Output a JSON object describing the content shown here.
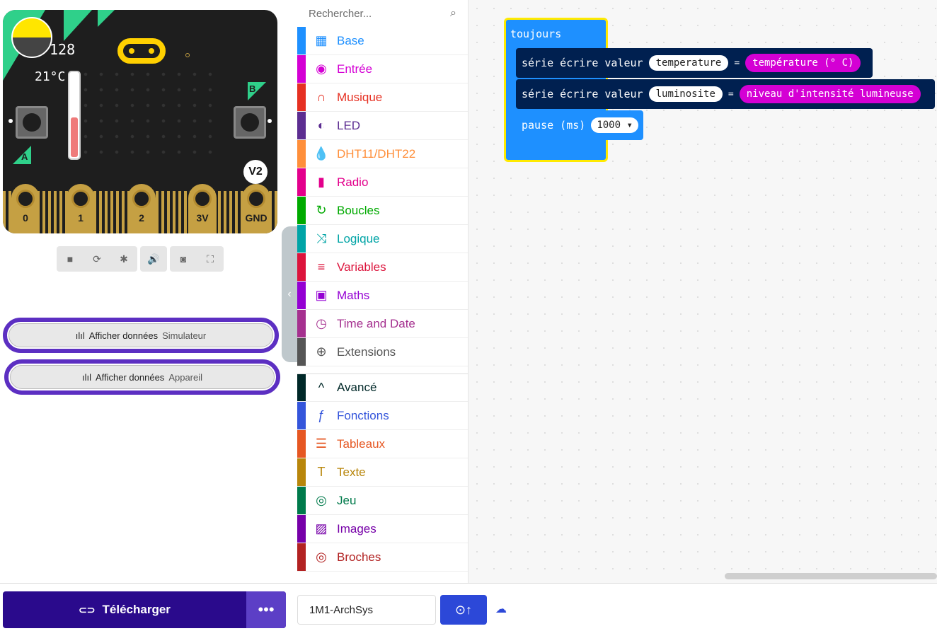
{
  "simulator": {
    "light_level": "128",
    "temperature": "21°C",
    "temperature_fill": 0.46,
    "button_a": "A",
    "button_b": "B",
    "version_badge": "V2",
    "pins": [
      "0",
      "1",
      "2",
      "3V",
      "GND"
    ],
    "controls": [
      "stop-icon",
      "restart-icon",
      "debug-icon",
      "sound-icon",
      "screenshot-icon",
      "fullscreen-icon"
    ]
  },
  "data_buttons": [
    {
      "label": "Afficher données",
      "sub": "Simulateur"
    },
    {
      "label": "Afficher données",
      "sub": "Appareil"
    }
  ],
  "toolbox": {
    "search_placeholder": "Rechercher...",
    "categories": [
      {
        "label": "Base",
        "color": "#1e90ff",
        "icon": "grid-icon"
      },
      {
        "label": "Entrée",
        "color": "#d400d4",
        "icon": "radio-button-icon"
      },
      {
        "label": "Musique",
        "color": "#e63022",
        "icon": "headphones-icon"
      },
      {
        "label": "LED",
        "color": "#5c2d91",
        "icon": "toggle-icon"
      },
      {
        "label": "DHT11/DHT22",
        "color": "#ff8f3a",
        "icon": "drop-icon"
      },
      {
        "label": "Radio",
        "color": "#e3008c",
        "icon": "signal-icon"
      },
      {
        "label": "Boucles",
        "color": "#00aa00",
        "icon": "refresh-icon"
      },
      {
        "label": "Logique",
        "color": "#00a4a6",
        "icon": "shuffle-icon"
      },
      {
        "label": "Variables",
        "color": "#dc143c",
        "icon": "list-icon"
      },
      {
        "label": "Maths",
        "color": "#9400d3",
        "icon": "calculator-icon"
      },
      {
        "label": "Time and Date",
        "color": "#a5308f",
        "icon": "clock-icon"
      },
      {
        "label": "Extensions",
        "color": "#555555",
        "icon": "plus-circle-icon"
      }
    ],
    "advanced": [
      {
        "label": "Avancé",
        "color": "#002828",
        "icon": "chevron-up-icon"
      },
      {
        "label": "Fonctions",
        "color": "#3455db",
        "icon": "function-icon"
      },
      {
        "label": "Tableaux",
        "color": "#e65722",
        "icon": "list-ordered-icon"
      },
      {
        "label": "Texte",
        "color": "#b8860b",
        "icon": "text-icon"
      },
      {
        "label": "Jeu",
        "color": "#007a4b",
        "icon": "gamepad-icon"
      },
      {
        "label": "Images",
        "color": "#7600a8",
        "icon": "image-icon"
      },
      {
        "label": "Broches",
        "color": "#b22222",
        "icon": "target-icon"
      }
    ]
  },
  "workspace": {
    "forever_label": "toujours",
    "serial_blocks": [
      {
        "text": "série écrire valeur",
        "name": "temperature",
        "eq": "=",
        "value": "température (° C)"
      },
      {
        "text": "série écrire valeur",
        "name": "luminosite",
        "eq": "=",
        "value": "niveau d'intensité lumineuse"
      }
    ],
    "pause": {
      "text": "pause (ms)",
      "value": "1000"
    }
  },
  "bottom": {
    "download_label": "Télécharger",
    "more_label": "•••",
    "project_name": "1M1-ArchSys"
  }
}
